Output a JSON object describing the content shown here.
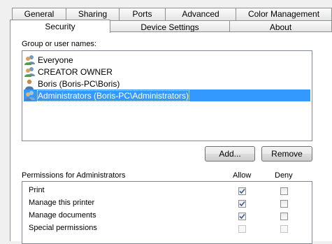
{
  "tabs_row1": [
    "General",
    "Sharing",
    "Ports",
    "Advanced",
    "Color Management"
  ],
  "tabs_row2": [
    "Security",
    "Device Settings",
    "About"
  ],
  "active_tab": "Security",
  "group_label": "Group or user names:",
  "users": [
    {
      "name": "Everyone",
      "icon": "group-user-icon",
      "selected": false
    },
    {
      "name": "CREATOR OWNER",
      "icon": "group-user-icon",
      "selected": false
    },
    {
      "name": "Boris (Boris-PC\\Boris)",
      "icon": "user-icon",
      "selected": false
    },
    {
      "name": "Administrators (Boris-PC\\Administrators)",
      "icon": "group-user-icon",
      "selected": true
    }
  ],
  "buttons": {
    "add": "Add...",
    "remove": "Remove"
  },
  "permissions": {
    "label": "Permissions for Administrators",
    "allow_header": "Allow",
    "deny_header": "Deny",
    "rows": [
      {
        "name": "Print",
        "allow": true,
        "deny": false,
        "enabled": true
      },
      {
        "name": "Manage this printer",
        "allow": true,
        "deny": false,
        "enabled": true
      },
      {
        "name": "Manage documents",
        "allow": true,
        "deny": false,
        "enabled": true
      },
      {
        "name": "Special permissions",
        "allow": false,
        "deny": false,
        "enabled": false
      }
    ]
  },
  "colors": {
    "selection": "#3399ff",
    "panel": "#ffffff",
    "window": "#f0f0f0"
  }
}
